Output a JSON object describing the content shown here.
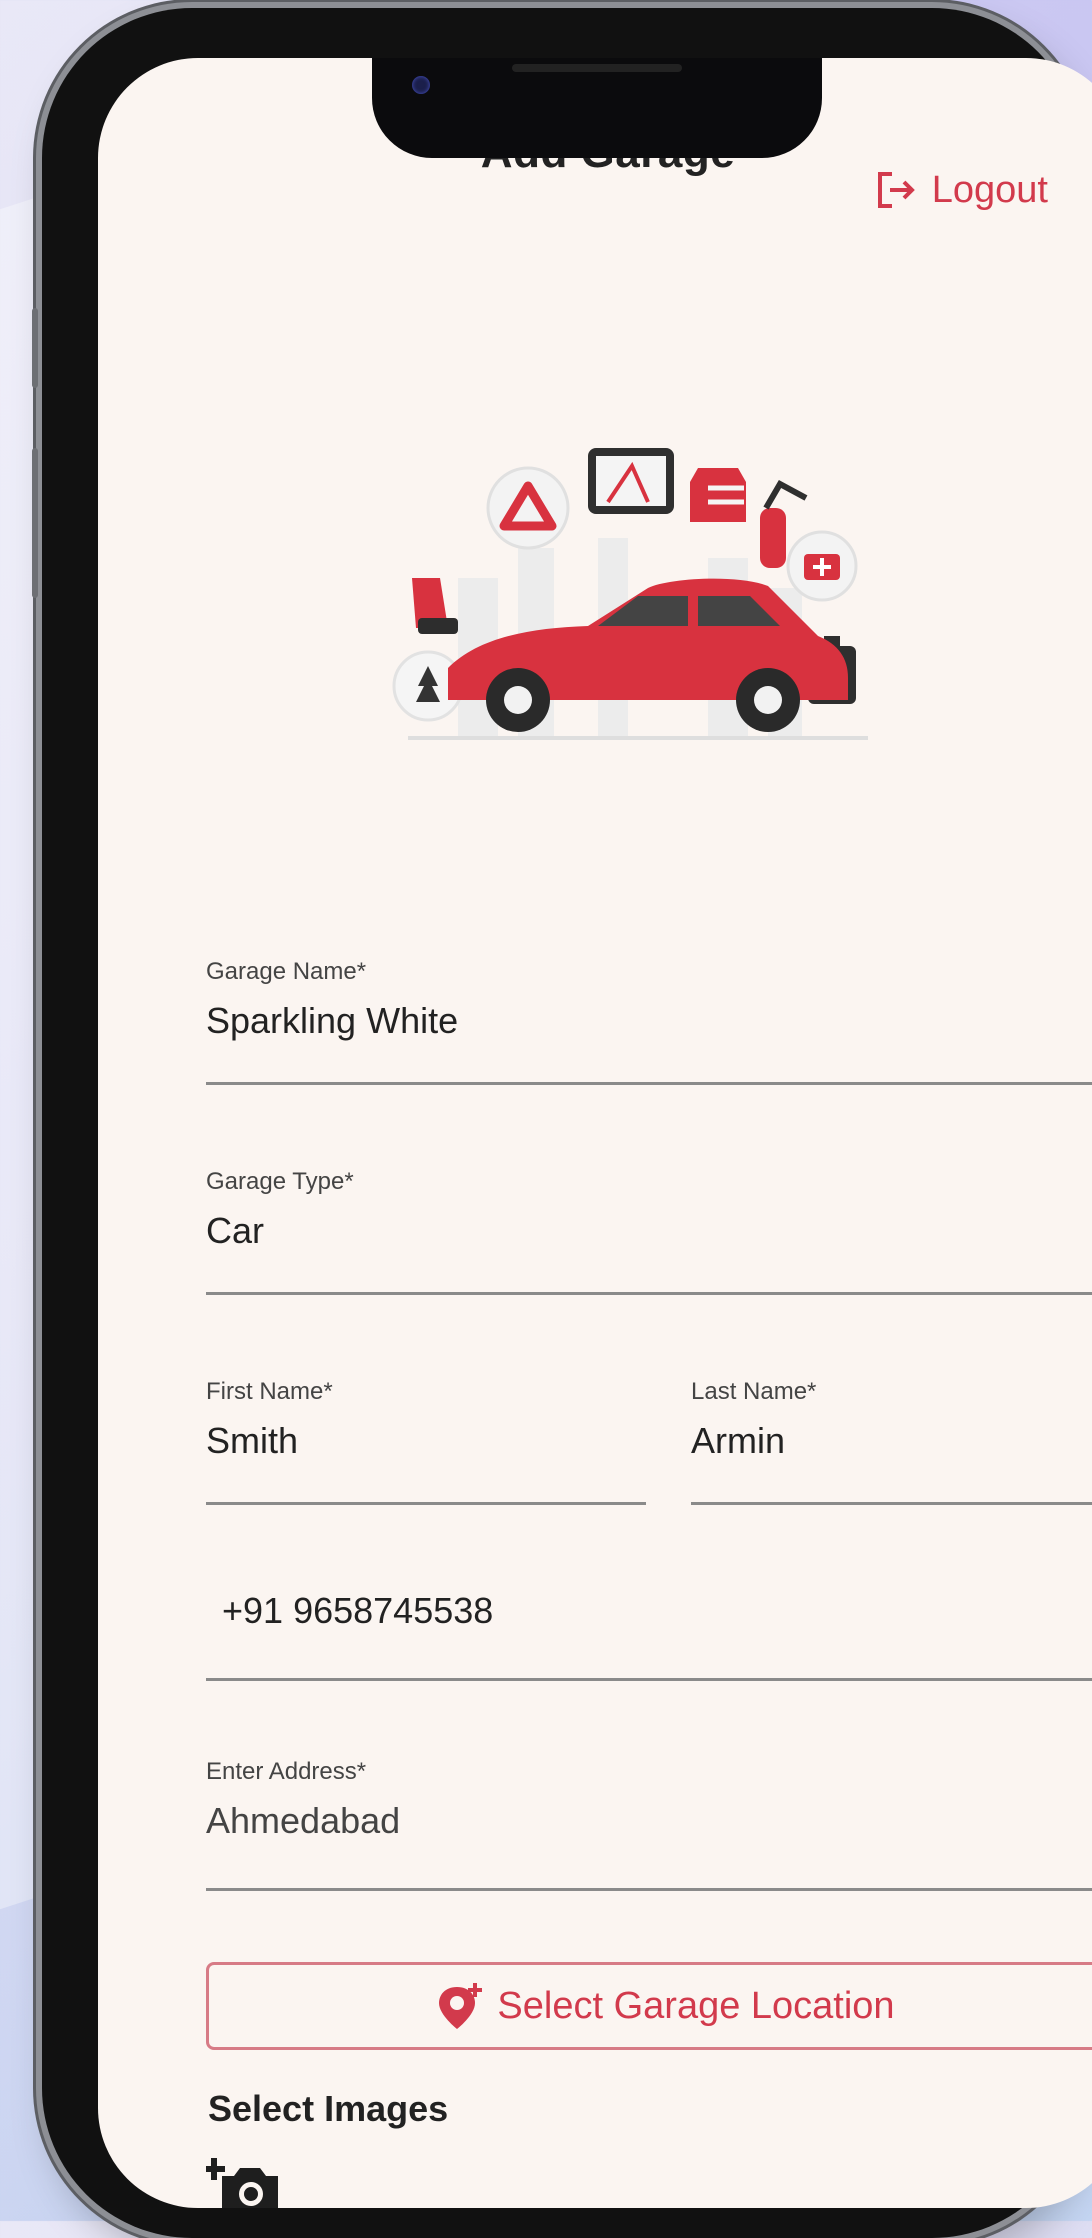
{
  "header": {
    "title": "Add Garage",
    "logout_label": "Logout"
  },
  "form": {
    "garage_name": {
      "label": "Garage Name*",
      "value": "Sparkling White"
    },
    "garage_type": {
      "label": "Garage Type*",
      "value": "Car"
    },
    "first_name": {
      "label": "First Name*",
      "value": "Smith"
    },
    "last_name": {
      "label": "Last Name*",
      "value": "Armin"
    },
    "phone": {
      "value": "+91 9658745538"
    },
    "address": {
      "label": "Enter Address*",
      "value": "Ahmedabad"
    },
    "location_button_label": "Select Garage Location",
    "images_label": "Select Images"
  },
  "colors": {
    "accent": "#d23a4c",
    "screen_bg": "#fbf5f1",
    "text": "#222222"
  },
  "icons": [
    "logout-icon",
    "car-accessories-illustration",
    "add-location-icon",
    "add-camera-icon"
  ]
}
